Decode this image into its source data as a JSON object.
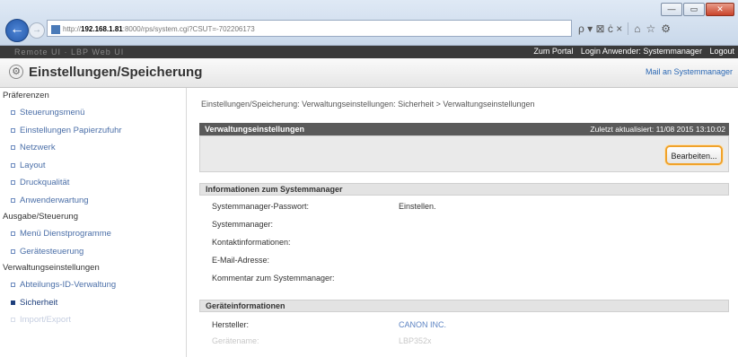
{
  "browser": {
    "url_prefix": "http://",
    "url_host": "192.168.1.81",
    "url_rest": ":8000/rps/system.cgi?CSUT=-702206173",
    "search_controls": "ρ ▾ ⊠ ċ ×",
    "win_min": "—",
    "win_max": "▭",
    "win_close": "✕"
  },
  "topbar": {
    "left_blur": "Remote UI · LBP Web UI",
    "portal_link": "Zum Portal",
    "login_text": "Login Anwender: Systemmanager",
    "logout_link": "Logout"
  },
  "header": {
    "title": "Einstellungen/Speicherung",
    "mail_link": "Mail an Systemmanager"
  },
  "sidebar": {
    "sections": [
      {
        "title": "Präferenzen",
        "items": [
          {
            "label": "Steuerungsmenü"
          },
          {
            "label": "Einstellungen Papierzufuhr"
          },
          {
            "label": "Netzwerk"
          },
          {
            "label": "Layout"
          },
          {
            "label": "Druckqualität"
          },
          {
            "label": "Anwenderwartung"
          }
        ]
      },
      {
        "title": "Ausgabe/Steuerung",
        "items": [
          {
            "label": "Menü Dienstprogramme"
          },
          {
            "label": "Gerätesteuerung"
          }
        ]
      },
      {
        "title": "Verwaltungseinstellungen",
        "items": [
          {
            "label": "Abteilungs-ID-Verwaltung"
          },
          {
            "label": "Sicherheit"
          },
          {
            "label": "Import/Export"
          }
        ]
      }
    ]
  },
  "main": {
    "breadcrumb": "Einstellungen/Speicherung: Verwaltungseinstellungen: Sicherheit > Verwaltungseinstellungen",
    "panel_title": "Verwaltungseinstellungen",
    "last_updated": "Zuletzt aktualisiert: 11/08 2015 13:10:02",
    "edit_button": "Bearbeiten...",
    "sysman_section": "Informationen zum Systemmanager",
    "sysman_rows": [
      {
        "label": "Systemmanager-Passwort:",
        "value": "Einstellen."
      },
      {
        "label": "Systemmanager:",
        "value": ""
      },
      {
        "label": "Kontaktinformationen:",
        "value": ""
      },
      {
        "label": "E-Mail-Adresse:",
        "value": ""
      },
      {
        "label": "Kommentar zum Systemmanager:",
        "value": ""
      }
    ],
    "device_section": "Geräteinformationen",
    "device_rows": [
      {
        "label": "Hersteller:",
        "value": "CANON INC."
      },
      {
        "label": "Gerätename:",
        "value": "LBP352x"
      }
    ]
  }
}
